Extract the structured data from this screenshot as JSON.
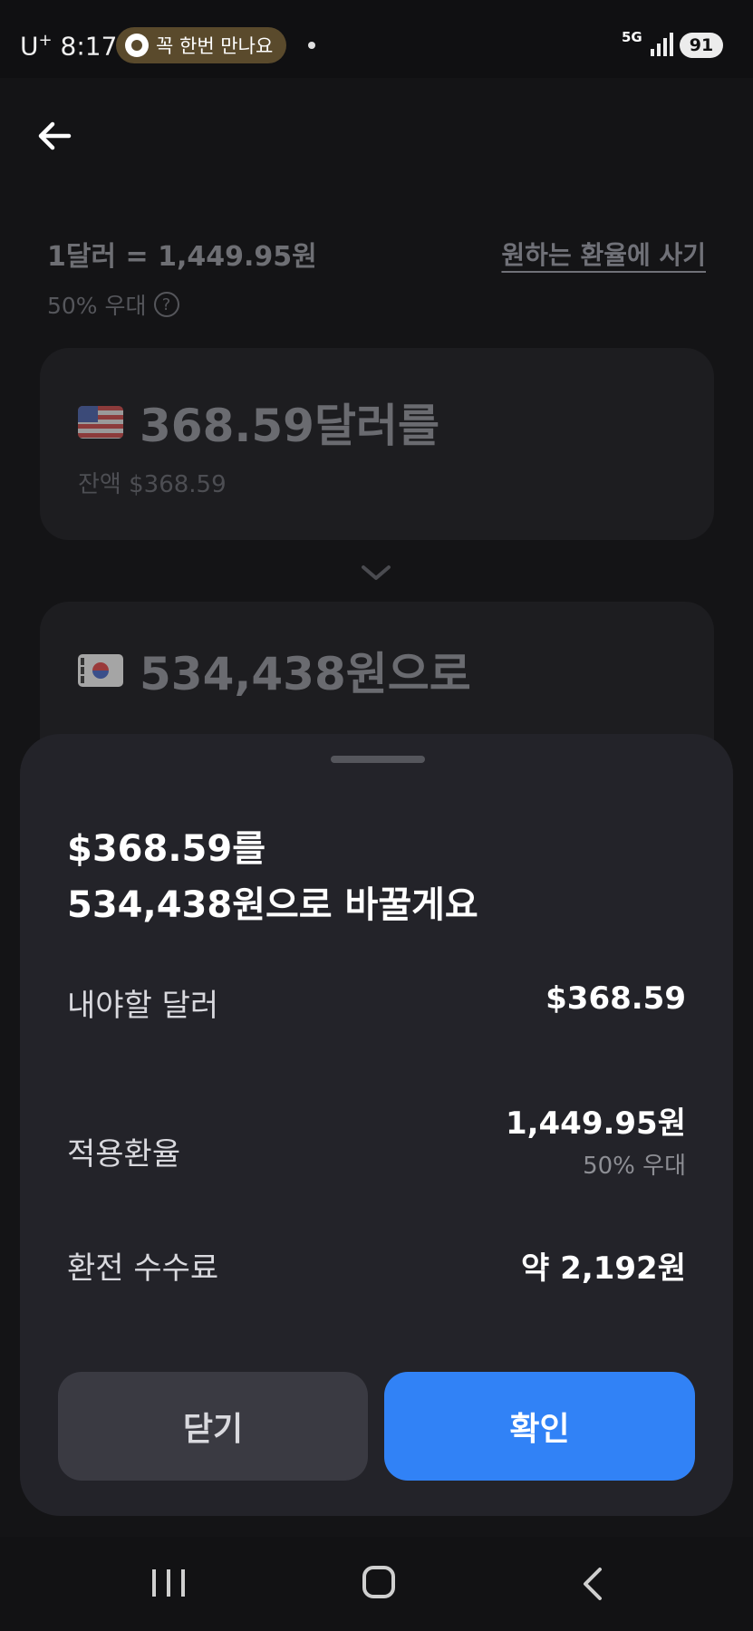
{
  "status_bar": {
    "carrier": "U",
    "carrier_sup": "+",
    "time": "8:17",
    "notification_pill": "꼭 한번 만나요",
    "network": "5G",
    "battery": "91"
  },
  "header": {
    "back_icon": "arrow-left-icon"
  },
  "exchange": {
    "rate": "1달러 = 1,449.95원",
    "discount": "50% 우대",
    "target_rate_link": "원하는 환율에 사기",
    "from_amount": "368.59달러를",
    "from_balance": "잔액 $368.59",
    "to_amount": "534,438원으로"
  },
  "sheet": {
    "title_line1": "$368.59를",
    "title_line2": "534,438원으로 바꿀게요",
    "rows": [
      {
        "label": "내야할 달러",
        "value": "$368.59"
      },
      {
        "label": "적용환율",
        "value": "1,449.95원",
        "subvalue": "50% 우대"
      },
      {
        "label": "환전 수수료",
        "value": "약 2,192원"
      }
    ],
    "close_label": "닫기",
    "confirm_label": "확인"
  },
  "colors": {
    "accent": "#3182f6",
    "sheet_bg": "#232329",
    "page_bg": "#141416"
  }
}
